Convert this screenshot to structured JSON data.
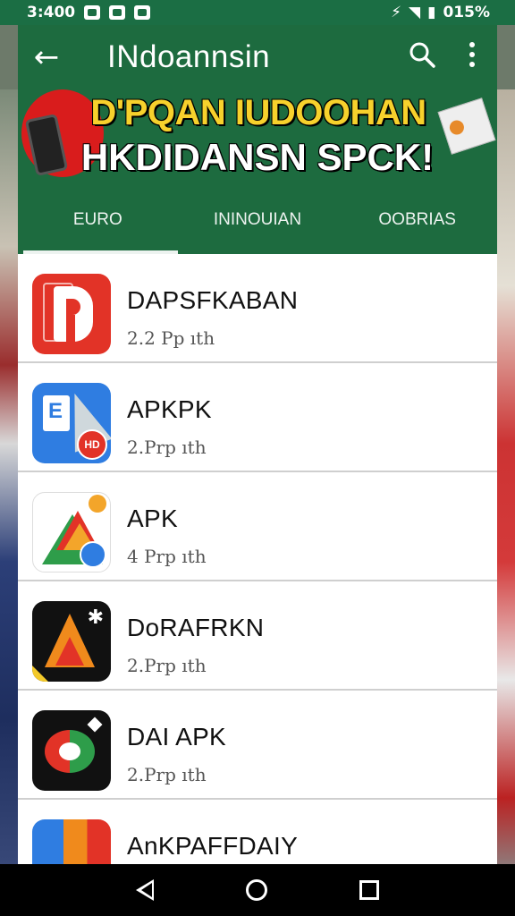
{
  "status_bar": {
    "time": "3:400",
    "battery": "015%"
  },
  "app_bar": {
    "title": "INdoannsin",
    "back_icon": "back-arrow-icon",
    "search_icon": "search-icon",
    "more_icon": "more-vert-icon"
  },
  "banner": {
    "line1": "D'PQAN IUDOOHAN",
    "line2": "HKDIDANSN SPCK!"
  },
  "tabs": [
    {
      "label": "EURO",
      "active": true
    },
    {
      "label": "ININOUIAN",
      "active": false
    },
    {
      "label": "OOBRIAS",
      "active": false
    }
  ],
  "apps": [
    {
      "name": "DAPSFKABAN",
      "meta": "2.2 Pp ıth"
    },
    {
      "name": "APKPK",
      "meta": "2.Prp ıth"
    },
    {
      "name": "APK",
      "meta": "4 Prp ıth"
    },
    {
      "name": "DoRAFRKN",
      "meta": "2.Prp ıth"
    },
    {
      "name": "DAI APK",
      "meta": "2.Prp ıth"
    },
    {
      "name": "AnKPAFFDAIY",
      "meta": ""
    }
  ],
  "colors": {
    "primary": "#1d6b3f",
    "accent": "#f7d12c"
  }
}
